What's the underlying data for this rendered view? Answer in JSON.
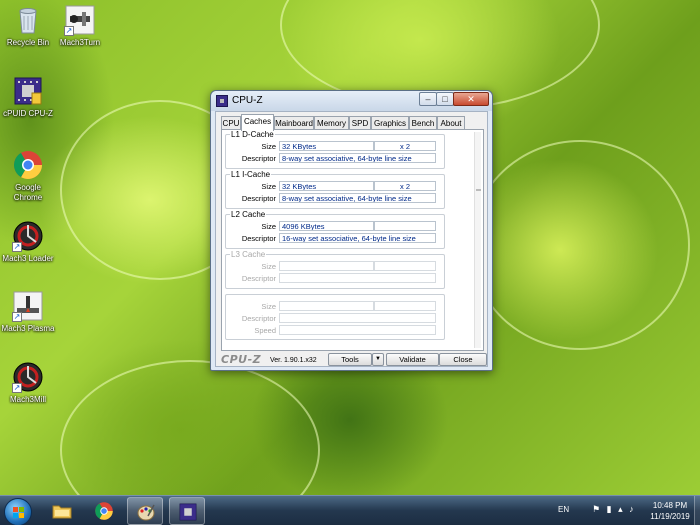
{
  "desktop": {
    "icons": [
      {
        "label": "Recycle Bin",
        "icon": "recycle-bin-icon"
      },
      {
        "label": "Mach3Turn",
        "icon": "mach3turn-icon"
      },
      {
        "label": "cPUID CPU-Z",
        "icon": "cpuz-icon"
      },
      {
        "label": "Google Chrome",
        "icon": "chrome-icon"
      },
      {
        "label": "Mach3 Loader",
        "icon": "mach3-loader-icon"
      },
      {
        "label": "Mach3 Plasma",
        "icon": "mach3-plasma-icon"
      },
      {
        "label": "Mach3Mill",
        "icon": "mach3mill-icon"
      }
    ]
  },
  "window": {
    "title": "CPU-Z",
    "minimize": "–",
    "maximize": "□",
    "close": "✕",
    "tabs": [
      "CPU",
      "Caches",
      "Mainboard",
      "Memory",
      "SPD",
      "Graphics",
      "Bench",
      "About"
    ],
    "active_tab": "Caches",
    "caches": {
      "l1d": {
        "title": "L1 D-Cache",
        "size_label": "Size",
        "size": "32 KBytes",
        "mult": "x 2",
        "desc_label": "Descriptor",
        "descriptor": "8-way set associative, 64-byte line size"
      },
      "l1i": {
        "title": "L1 I-Cache",
        "size_label": "Size",
        "size": "32 KBytes",
        "mult": "x 2",
        "desc_label": "Descriptor",
        "descriptor": "8-way set associative, 64-byte line size"
      },
      "l2": {
        "title": "L2 Cache",
        "size_label": "Size",
        "size": "4096 KBytes",
        "mult": "",
        "desc_label": "Descriptor",
        "descriptor": "16-way set associative, 64-byte line size"
      },
      "l3": {
        "title": "L3 Cache",
        "size_label": "Size",
        "desc_label": "Descriptor"
      },
      "extra": {
        "size_label": "Size",
        "desc_label": "Descriptor",
        "speed_label": "Speed"
      }
    },
    "footer": {
      "logo": "CPU-Z",
      "version": "Ver. 1.90.1.x32",
      "tools": "Tools",
      "tools_arrow": "▼",
      "validate": "Validate",
      "close": "Close"
    }
  },
  "taskbar": {
    "language": "EN",
    "time": "10:48 PM",
    "date": "11/19/2019"
  },
  "colors": {
    "value_text": "#002a8a",
    "taskbar": "#24384f",
    "wallpaper": "#8cbf2a"
  }
}
